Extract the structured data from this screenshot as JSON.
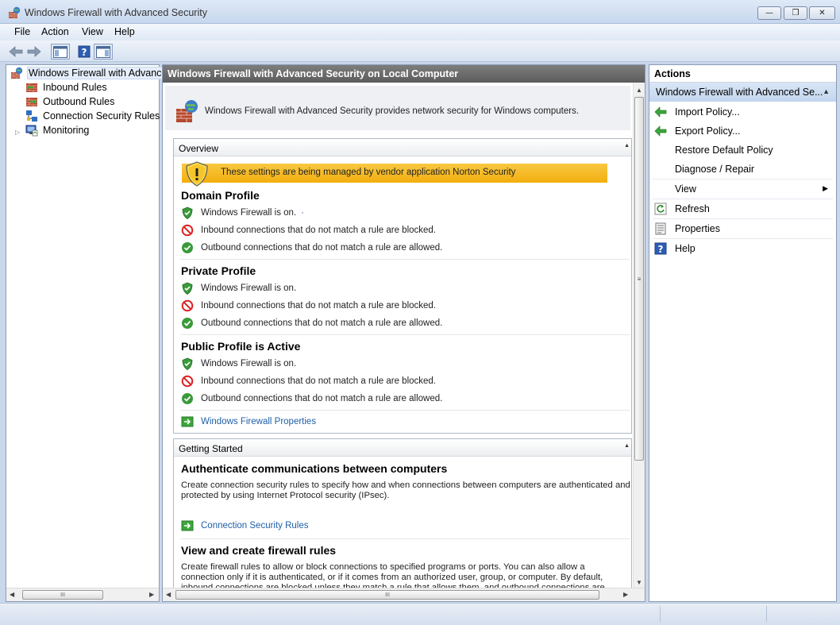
{
  "window": {
    "title": "Windows Firewall with Advanced Security",
    "min_symbol": "—",
    "max_symbol": "❐",
    "close_symbol": "✕"
  },
  "menu": [
    "File",
    "Action",
    "View",
    "Help"
  ],
  "toolbar": {
    "icons": [
      "back-arrow-icon",
      "forward-arrow-icon",
      "show-hide-console-tree-icon",
      "help-icon",
      "show-hide-action-pane-icon"
    ]
  },
  "tree": {
    "items": [
      {
        "label": "Windows Firewall with Advance",
        "icon": "firewall-icon",
        "selected": true
      },
      {
        "label": "Inbound Rules",
        "icon": "inbound-rules-icon"
      },
      {
        "label": "Outbound Rules",
        "icon": "outbound-rules-icon"
      },
      {
        "label": "Connection Security Rules",
        "icon": "connection-security-icon"
      },
      {
        "label": "Monitoring",
        "icon": "monitoring-icon"
      }
    ],
    "expander": "▷"
  },
  "scrollbar": {
    "grip": "III",
    "left": "◀",
    "right": "▶",
    "up": "▲",
    "down": "▼",
    "vgrip": "≡"
  },
  "main": {
    "header": "Windows Firewall with Advanced Security on Local Computer",
    "intro": "Windows Firewall with Advanced Security provides network security for Windows computers.",
    "overview": {
      "title": "Overview",
      "collapse": "▲",
      "banner": "These settings are being managed by vendor application Norton Security",
      "profiles": [
        {
          "title": "Domain Profile",
          "lines": [
            {
              "icon": "shield-check-icon",
              "text": "Windows Firewall is on.",
              "extra": "·"
            },
            {
              "icon": "blocked-icon",
              "text": "Inbound connections that do not match a rule are blocked."
            },
            {
              "icon": "allowed-check-icon",
              "text": "Outbound connections that do not match a rule are allowed."
            }
          ]
        },
        {
          "title": "Private Profile",
          "lines": [
            {
              "icon": "shield-check-icon",
              "text": "Windows Firewall is on."
            },
            {
              "icon": "blocked-icon",
              "text": "Inbound connections that do not match a rule are blocked."
            },
            {
              "icon": "allowed-check-icon",
              "text": "Outbound connections that do not match a rule are allowed."
            }
          ]
        },
        {
          "title": "Public Profile is Active",
          "lines": [
            {
              "icon": "shield-check-icon",
              "text": "Windows Firewall is on."
            },
            {
              "icon": "blocked-icon",
              "text": "Inbound connections that do not match a rule are blocked."
            },
            {
              "icon": "allowed-check-icon",
              "text": "Outbound connections that do not match a rule are allowed."
            }
          ]
        }
      ],
      "properties_link": "Windows Firewall Properties"
    },
    "getting_started": {
      "title": "Getting Started",
      "collapse": "▲",
      "auth_title": "Authenticate communications between computers",
      "auth_text": "Create connection security rules to specify how and when connections between computers are authenticated and protected by using Internet Protocol security (IPsec).",
      "auth_link": "Connection Security Rules",
      "rules_title": "View and create firewall rules",
      "rules_text": "Create firewall rules to allow or block connections to specified programs or ports. You can also allow a connection only if it is authenticated, or if it comes from an authorized user, group, or computer. By default, inbound connections are blocked unless they match a rule that allows them, and outbound connections are allowed unless they match a rule that"
    }
  },
  "actions": {
    "title": "Actions",
    "subtitle": "Windows Firewall with Advanced Se...",
    "collapse": "▲",
    "submenu_arrow": "▶",
    "items": [
      {
        "label": "Import Policy...",
        "icon": "import-policy-icon"
      },
      {
        "label": "Export Policy...",
        "icon": "export-policy-icon"
      },
      {
        "label": "Restore Default Policy",
        "icon": ""
      },
      {
        "label": "Diagnose / Repair",
        "icon": ""
      },
      {
        "label": "View",
        "icon": "",
        "submenu": true
      },
      {
        "label": "Refresh",
        "icon": "refresh-icon"
      },
      {
        "label": "Properties",
        "icon": "properties-icon"
      },
      {
        "label": "Help",
        "icon": "help-icon"
      }
    ]
  },
  "colors": {
    "banner": "#f4b41a",
    "link": "#1f5fa8",
    "header": "#6b6b6b"
  }
}
